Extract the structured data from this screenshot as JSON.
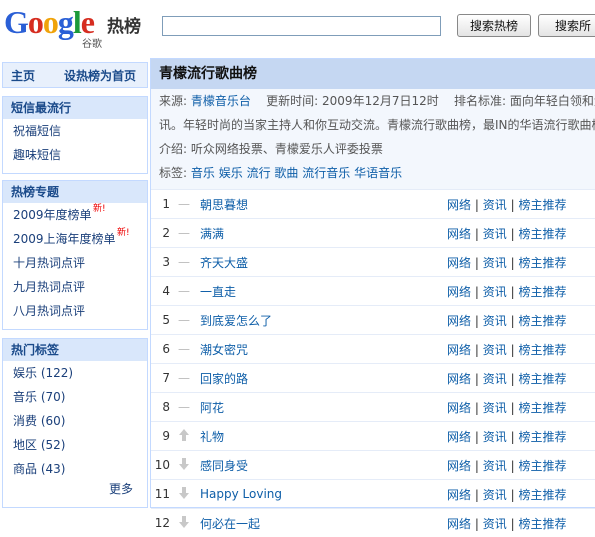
{
  "header": {
    "logo_text": "Google",
    "logo_sub": "谷歌",
    "brand": "热榜",
    "search_value": "",
    "search_button": "搜索热榜",
    "search_all_button": "搜索所"
  },
  "nav": {
    "home": "主页",
    "set_home": "设热榜为首页"
  },
  "sidebar": {
    "sms": {
      "title": "短信最流行",
      "items": [
        "祝福短信",
        "趣味短信"
      ]
    },
    "special": {
      "title": "热榜专题",
      "items": [
        "2009年度榜单",
        "2009上海年度榜单",
        "十月热词点评",
        "九月热词点评",
        "八月热词点评"
      ],
      "new_badge": "新!"
    },
    "tags": {
      "title": "热门标签",
      "items": [
        "娱乐 (122)",
        "音乐 (70)",
        "消费 (60)",
        "地区 (52)",
        "商品 (43)"
      ],
      "more": "更多"
    }
  },
  "main": {
    "title": "青檬流行歌曲榜",
    "source_label": "来源:",
    "source_value": "青檬音乐台",
    "updated_label": "更新时间:",
    "updated_value": "2009年12月7日12时",
    "criteria_label": "排名标准:",
    "criteria_value": "面向年轻白领和大",
    "desc_cont": "讯。年轻时尚的当家主持人和你互动交流。青檬流行歌曲榜，最IN的华语流行歌曲榜。",
    "intro_label": "介绍:",
    "intro_value": "听众网络投票、青檬爱乐人评委投票",
    "tags_label": "标签:",
    "tags": [
      "音乐",
      "娱乐",
      "流行",
      "歌曲",
      "流行音乐",
      "华语音乐"
    ],
    "actions": {
      "web": "网络",
      "news": "资讯",
      "recommend": "榜主推荐",
      "sep": "|"
    },
    "songs": [
      {
        "rank": "1",
        "trend": "—",
        "title": "朝思暮想"
      },
      {
        "rank": "2",
        "trend": "—",
        "title": "满满"
      },
      {
        "rank": "3",
        "trend": "—",
        "title": "齐天大盛"
      },
      {
        "rank": "4",
        "trend": "—",
        "title": "一直走"
      },
      {
        "rank": "5",
        "trend": "—",
        "title": "到底爱怎么了"
      },
      {
        "rank": "6",
        "trend": "—",
        "title": "潮女密咒"
      },
      {
        "rank": "7",
        "trend": "—",
        "title": "回家的路"
      },
      {
        "rank": "8",
        "trend": "—",
        "title": "阿花"
      },
      {
        "rank": "9",
        "trend": "up",
        "title": "礼物"
      },
      {
        "rank": "10",
        "trend": "down",
        "title": "感同身受"
      },
      {
        "rank": "11",
        "trend": "down",
        "title": "Happy Loving"
      },
      {
        "rank": "12",
        "trend": "down",
        "title": "何必在一起"
      }
    ]
  },
  "colors": {
    "google_blue": "#2a5fd6",
    "google_red": "#d62d20",
    "google_yellow": "#f0a30a",
    "google_green": "#1c9a3a",
    "link": "#0e5ea8"
  }
}
